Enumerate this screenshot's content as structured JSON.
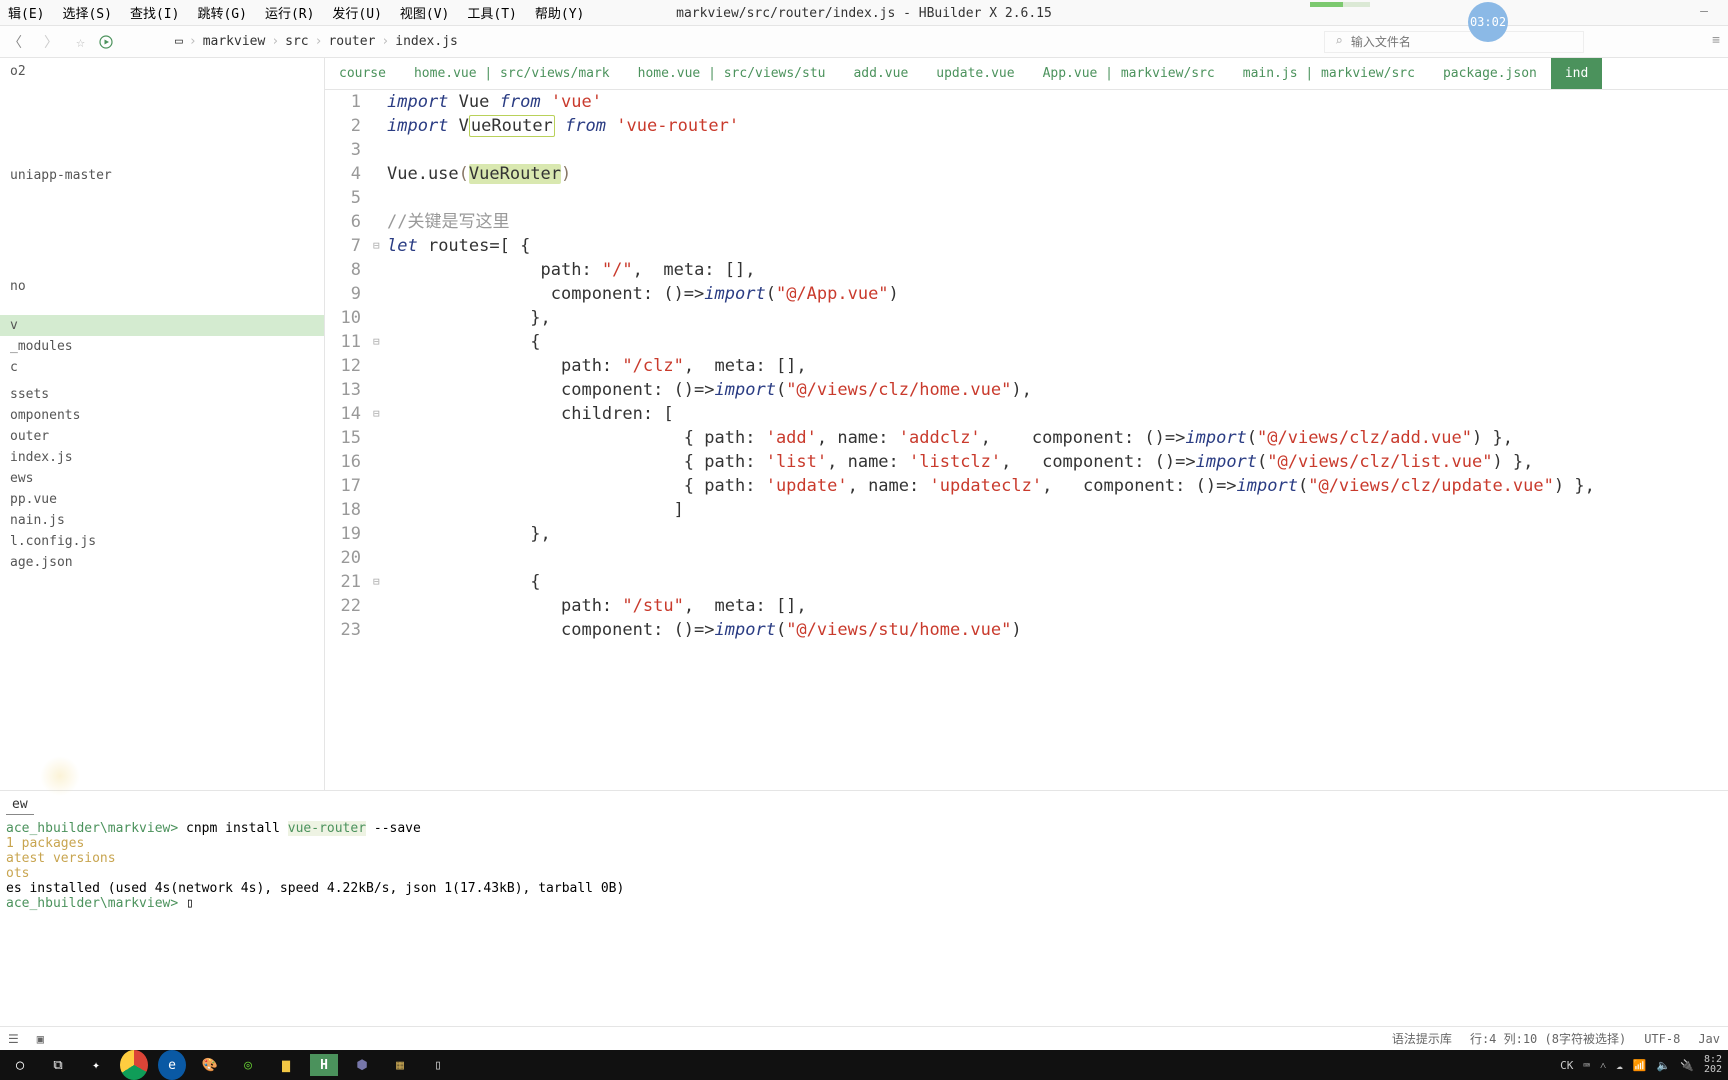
{
  "window_title": "markview/src/router/index.js - HBuilder X 2.6.15",
  "menu": [
    "辑(E)",
    "选择(S)",
    "查找(I)",
    "跳转(G)",
    "运行(R)",
    "发行(U)",
    "视图(V)",
    "工具(T)",
    "帮助(Y)"
  ],
  "breadcrumb": [
    "markview",
    "src",
    "router",
    "index.js"
  ],
  "search_placeholder": "输入文件名",
  "overlay_clock": "03:02",
  "tabs_left": [
    "o2"
  ],
  "sidebar_misc_top": [
    "uniapp-master",
    "no"
  ],
  "sidebar_items": [
    "v",
    "_modules",
    "c",
    "",
    "ssets",
    "omponents",
    "outer",
    "   index.js",
    "ews",
    "pp.vue",
    "nain.js",
    "l.config.js",
    "age.json"
  ],
  "sidebar_selected": 0,
  "tabs": [
    {
      "label": "course"
    },
    {
      "label": "home.vue | src/views/mark"
    },
    {
      "label": "home.vue | src/views/stu"
    },
    {
      "label": "add.vue"
    },
    {
      "label": "update.vue"
    },
    {
      "label": "App.vue | markview/src"
    },
    {
      "label": "main.js | markview/src"
    },
    {
      "label": "package.json"
    },
    {
      "label": "ind",
      "active": true
    }
  ],
  "lines": [
    {
      "n": 1,
      "html": "<span class='kw'>import</span> Vue <span class='kw'>from</span> <span class='str'>'vue'</span>"
    },
    {
      "n": 2,
      "html": "<span class='kw'>import</span> V<span class='hlbox'>ueRouter</span> <span class='kw'>from</span> <span class='str'>'vue-router'</span>"
    },
    {
      "n": 3,
      "html": ""
    },
    {
      "n": 4,
      "html": "Vue.use<span class='br'>(</span><span class='hlfill'>VueRouter</span><span class='br'>)</span>"
    },
    {
      "n": 5,
      "html": ""
    },
    {
      "n": 6,
      "html": "<span class='cmt'>//关键是写这里</span>"
    },
    {
      "n": 7,
      "fold": "⊟",
      "html": "<span class='kw'>let</span> routes=[ {"
    },
    {
      "n": 8,
      "html": "               path: <span class='str'>\"/\"</span>,  meta: [],"
    },
    {
      "n": 9,
      "html": "                component: ()=&gt;<span class='imp'>import</span>(<span class='str'>\"@/App.vue\"</span>)"
    },
    {
      "n": 10,
      "html": "              },"
    },
    {
      "n": 11,
      "fold": "⊟",
      "html": "              {"
    },
    {
      "n": 12,
      "html": "                 path: <span class='str'>\"/clz\"</span>,  meta: [],"
    },
    {
      "n": 13,
      "html": "                 component: ()=&gt;<span class='imp'>import</span>(<span class='str'>\"@/views/clz/home.vue\"</span>),"
    },
    {
      "n": 14,
      "fold": "⊟",
      "html": "                 children: ["
    },
    {
      "n": 15,
      "html": "                             { path: <span class='str'>'add'</span>, name: <span class='str'>'addclz'</span>,    component: ()=&gt;<span class='imp'>import</span>(<span class='str'>\"@/views/clz/add.vue\"</span>) },"
    },
    {
      "n": 16,
      "html": "                             { path: <span class='str'>'list'</span>, name: <span class='str'>'listclz'</span>,   component: ()=&gt;<span class='imp'>import</span>(<span class='str'>\"@/views/clz/list.vue\"</span>) },"
    },
    {
      "n": 17,
      "html": "                             { path: <span class='str'>'update'</span>, name: <span class='str'>'updateclz'</span>,   component: ()=&gt;<span class='imp'>import</span>(<span class='str'>\"@/views/clz/update.vue\"</span>) },"
    },
    {
      "n": 18,
      "html": "                            ]"
    },
    {
      "n": 19,
      "html": "              },"
    },
    {
      "n": 20,
      "html": ""
    },
    {
      "n": 21,
      "fold": "⊟",
      "html": "              {"
    },
    {
      "n": 22,
      "html": "                 path: <span class='str'>\"/stu\"</span>,  meta: [],"
    },
    {
      "n": 23,
      "html": "                 component: ()=&gt;<span class='imp'>import</span>(<span class='str'>\"@/views/stu/home.vue\"</span>)"
    }
  ],
  "terminal_tab": "ew",
  "terminal": {
    "prompt_path": "ace_hbuilder\\markview>",
    "cmd": " cnpm install ",
    "pkg": "vue-router",
    "cmd2": " --save",
    "l2": "1 packages",
    "l3": "atest versions",
    "l4": "ots",
    "l5": "es installed (used 4s(network 4s), speed 4.22kB/s, json 1(17.43kB), tarball 0B)",
    "prompt2": "ace_hbuilder\\markview>"
  },
  "status": {
    "syntax": "语法提示库",
    "rowcol": "行:4   列:10 (8字符被选择)",
    "enc": "UTF-8",
    "lang": "Jav"
  },
  "tray_time": "8:2\n202",
  "ime": "CK"
}
